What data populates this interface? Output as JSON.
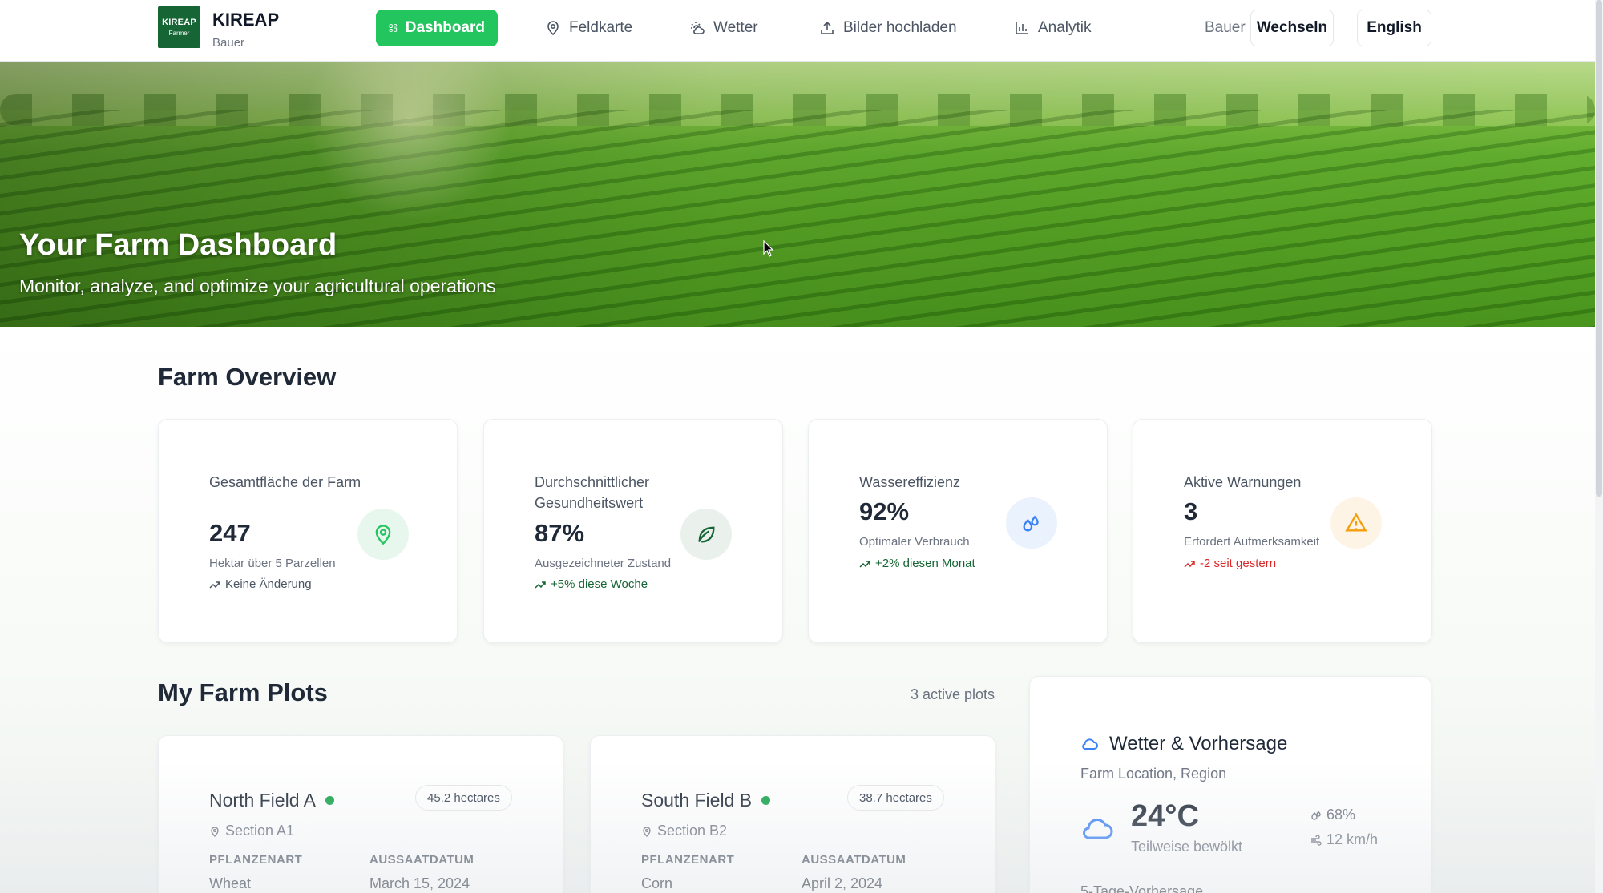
{
  "header": {
    "logo_line1": "KIREAP",
    "logo_line2": "Farmer",
    "brand_title": "KIREAP",
    "brand_subtitle": "Bauer",
    "nav": [
      {
        "label": "Dashboard",
        "icon": "dashboard-grid-icon",
        "active": true
      },
      {
        "label": "Feldkarte",
        "icon": "map-pin-icon",
        "active": false
      },
      {
        "label": "Wetter",
        "icon": "sun-cloud-icon",
        "active": false
      },
      {
        "label": "Bilder hochladen",
        "icon": "upload-icon",
        "active": false
      },
      {
        "label": "Analytik",
        "icon": "bar-chart-icon",
        "active": false
      }
    ],
    "role_label": "Bauer",
    "switch_button": "Wechseln",
    "language_button": "English"
  },
  "hero": {
    "title": "Your Farm Dashboard",
    "subtitle": "Monitor, analyze, and optimize your agricultural operations"
  },
  "overview": {
    "title": "Farm Overview",
    "cards": [
      {
        "label": "Gesamtfläche der Farm",
        "value": "247",
        "description": "Hektar über 5 Parzellen",
        "trend": "Keine Änderung",
        "trend_color": "#4b5563",
        "icon": "map-pin-icon",
        "icon_color": "#22c55e",
        "icon_bg": "#e8f7ee"
      },
      {
        "label": "Durchschnittlicher Gesundheitswert",
        "value": "87%",
        "description": "Ausgezeichneter Zustand",
        "trend": "+5% diese Woche",
        "trend_color": "#166534",
        "icon": "leaf-icon",
        "icon_color": "#166534",
        "icon_bg": "#eaf1ec"
      },
      {
        "label": "Wassereffizienz",
        "value": "92%",
        "description": "Optimaler Verbrauch",
        "trend": "+2% diesen Monat",
        "trend_color": "#166534",
        "icon": "water-drops-icon",
        "icon_color": "#3b82f6",
        "icon_bg": "#eaf2fd"
      },
      {
        "label": "Aktive Warnungen",
        "value": "3",
        "description": "Erfordert Aufmerksamkeit",
        "trend": "-2 seit gestern",
        "trend_color": "#dc2626",
        "icon": "warning-triangle-icon",
        "icon_color": "#f59e0b",
        "icon_bg": "#fdf4e6"
      }
    ]
  },
  "plots": {
    "title": "My Farm Plots",
    "count_label": "3 active plots",
    "crop_header": "PFLANZENART",
    "date_header": "AUSSAATDATUM",
    "items": [
      {
        "name": "North Field A",
        "size": "45.2 hectares",
        "section": "Section A1",
        "crop": "Wheat",
        "sowing_date": "March 15, 2024"
      },
      {
        "name": "South Field B",
        "size": "38.7 hectares",
        "section": "Section B2",
        "crop": "Corn",
        "sowing_date": "April 2, 2024"
      }
    ]
  },
  "weather": {
    "title": "Wetter & Vorhersage",
    "location": "Farm Location, Region",
    "temperature": "24°C",
    "condition": "Teilweise bewölkt",
    "humidity": "68%",
    "wind": "12 km/h",
    "forecast_label": "5-Tage-Vorhersage"
  },
  "colors": {
    "accent": "#22c55e",
    "brand_dark": "#166534"
  }
}
